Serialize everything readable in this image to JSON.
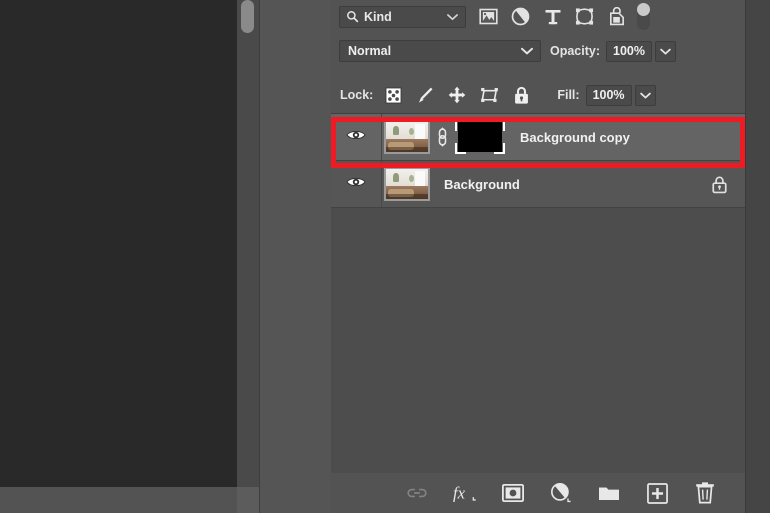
{
  "colors": {
    "panel_bg": "#535353",
    "list_bg": "#4d4d4d",
    "row_selected": "#646464",
    "row_normal": "#565656",
    "canvas_bg": "#292929",
    "highlight_red": "#ee1b24",
    "text": "#f0f0f0",
    "mask_fill": "#000000"
  },
  "canvas": {
    "name": "document-canvas",
    "vertical_scrollbar": "vertical-scrollbar",
    "horizontal_scrollbar": "horizontal-scrollbar"
  },
  "filter_row": {
    "kind_label": "Kind",
    "search_icon": "search-icon",
    "dropdown_icon": "chevron-down-icon",
    "icons": [
      {
        "name": "filter-pixel-layers-icon",
        "label": "Pixel Layers"
      },
      {
        "name": "filter-adjustment-layers-icon",
        "label": "Adjustment Layers"
      },
      {
        "name": "filter-type-layers-icon",
        "label": "Type Layers"
      },
      {
        "name": "filter-shape-layers-icon",
        "label": "Shape Layers"
      },
      {
        "name": "filter-smart-objects-icon",
        "label": "Smart Objects"
      }
    ],
    "toggle": {
      "name": "filter-enable-toggle",
      "state": "on"
    }
  },
  "blend_row": {
    "blend_mode": "Normal",
    "blend_dropdown_icon": "chevron-down-icon",
    "opacity_label": "Opacity:",
    "opacity_value": "100%",
    "opacity_dropdown_icon": "chevron-down-icon"
  },
  "lock_row": {
    "lock_label": "Lock:",
    "icons": [
      {
        "name": "lock-transparent-pixels-icon",
        "label": "Lock transparent pixels"
      },
      {
        "name": "lock-image-pixels-icon",
        "label": "Lock image pixels"
      },
      {
        "name": "lock-position-icon",
        "label": "Lock position"
      },
      {
        "name": "lock-artboard-nesting-icon",
        "label": "Prevent auto-nesting"
      },
      {
        "name": "lock-all-icon",
        "label": "Lock all"
      }
    ],
    "fill_label": "Fill:",
    "fill_value": "100%",
    "fill_dropdown_icon": "chevron-down-icon"
  },
  "layers": [
    {
      "name": "Background copy",
      "visible": true,
      "selected": true,
      "has_mask": true,
      "mask_selected": true,
      "mask_type": "black",
      "linked": true,
      "locked": false,
      "visibility_icon": "eye-icon",
      "link_icon": "link-chain-icon"
    },
    {
      "name": "Background",
      "visible": true,
      "selected": false,
      "has_mask": false,
      "mask_selected": false,
      "linked": false,
      "locked": true,
      "visibility_icon": "eye-icon",
      "lock_icon": "lock-icon"
    }
  ],
  "highlight": {
    "name": "selection-highlight-rectangle",
    "target": "Background copy"
  },
  "bottom_bar": {
    "buttons": [
      {
        "name": "link-layers-button",
        "icon": "link-icon",
        "label": "Link layers",
        "enabled": false
      },
      {
        "name": "layer-style-button",
        "icon": "fx-icon",
        "label": "Add a layer style"
      },
      {
        "name": "add-layer-mask-button",
        "icon": "mask-icon",
        "label": "Add layer mask"
      },
      {
        "name": "new-adjustment-layer-button",
        "icon": "half-filled-circle-icon",
        "label": "Create new fill or adjustment layer"
      },
      {
        "name": "new-group-button",
        "icon": "folder-icon",
        "label": "Create a new group"
      },
      {
        "name": "new-layer-button",
        "icon": "plus-square-icon",
        "label": "Create a new layer"
      },
      {
        "name": "delete-layer-button",
        "icon": "trash-icon",
        "label": "Delete layer"
      }
    ]
  }
}
